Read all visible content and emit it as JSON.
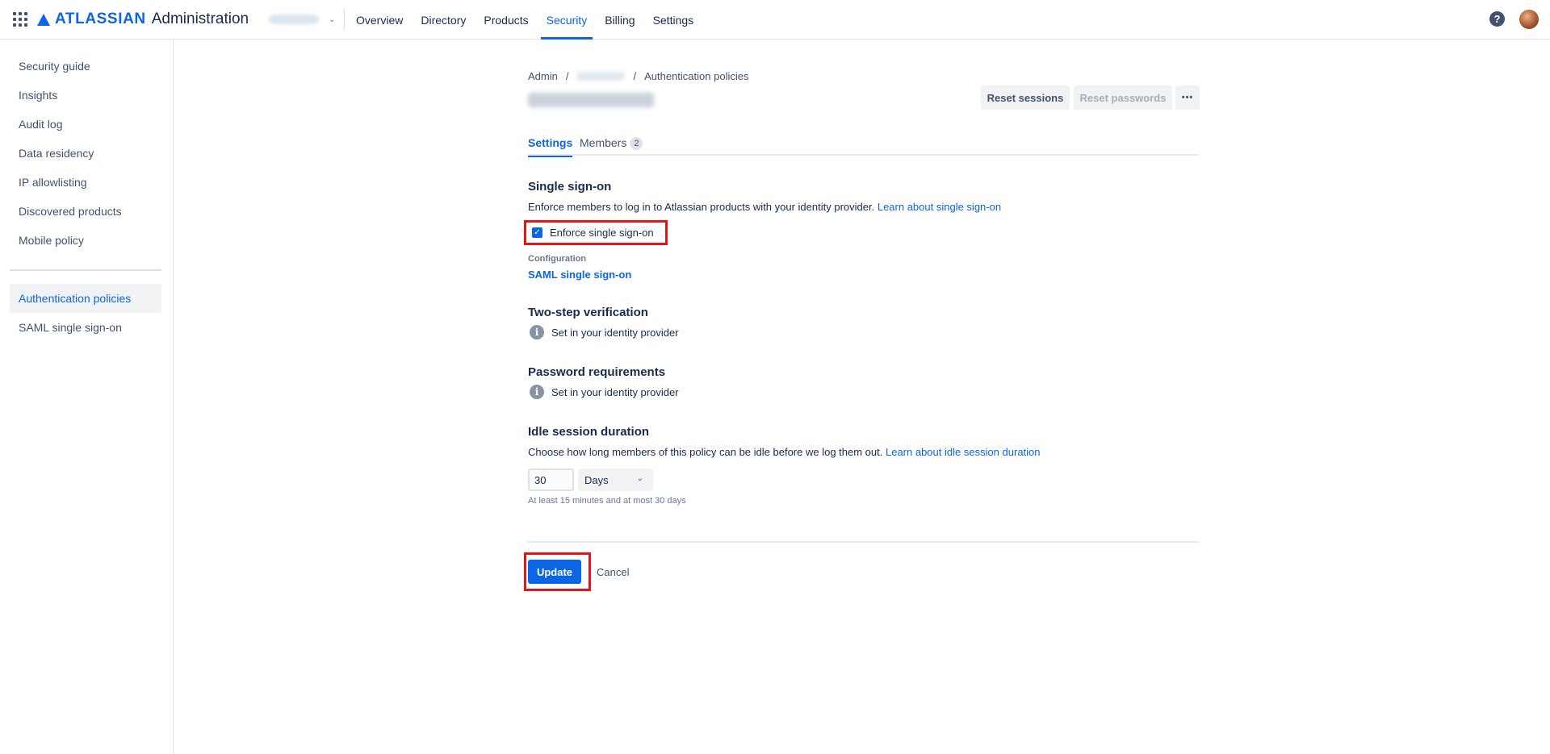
{
  "colors": {
    "primary": "#0C66E4",
    "highlight": "#E5141B",
    "text": "#172B4D"
  },
  "topbar": {
    "brand": "ATLASSIAN",
    "product": "Administration",
    "nav": [
      {
        "label": "Overview"
      },
      {
        "label": "Directory"
      },
      {
        "label": "Products"
      },
      {
        "label": "Security",
        "active": true
      },
      {
        "label": "Billing"
      },
      {
        "label": "Settings"
      }
    ],
    "help_icon": "?"
  },
  "sidebar": {
    "items": [
      {
        "label": "Security guide"
      },
      {
        "label": "Insights"
      },
      {
        "label": "Audit log"
      },
      {
        "label": "Data residency"
      },
      {
        "label": "IP allowlisting"
      },
      {
        "label": "Discovered products"
      },
      {
        "label": "Mobile policy"
      },
      {
        "label": "Authentication policies",
        "active": true
      },
      {
        "label": "SAML single sign-on"
      }
    ]
  },
  "breadcrumb": {
    "root": "Admin",
    "separator": "/",
    "current": "Authentication policies"
  },
  "header": {
    "reset_sessions": "Reset sessions",
    "reset_passwords": "Reset passwords",
    "more": "•••"
  },
  "tabs": [
    {
      "label": "Settings",
      "active": true
    },
    {
      "label": "Members",
      "badge": "2"
    }
  ],
  "sso": {
    "title": "Single sign-on",
    "description": "Enforce members to log in to Atlassian products with your identity provider.",
    "learn_link": "Learn about single sign-on",
    "checkbox_label": "Enforce single sign-on",
    "checkbox_checked": true,
    "config_label": "Configuration",
    "config_link": "SAML single sign-on"
  },
  "two_step": {
    "title": "Two-step verification",
    "info": "Set in your identity provider"
  },
  "password": {
    "title": "Password requirements",
    "info": "Set in your identity provider"
  },
  "idle": {
    "title": "Idle session duration",
    "description": "Choose how long members of this policy can be idle before we log them out.",
    "learn_link": "Learn about idle session duration",
    "value": "30",
    "unit": "Days",
    "helper": "At least 15 minutes and at most 30 days"
  },
  "actions": {
    "update": "Update",
    "cancel": "Cancel"
  }
}
